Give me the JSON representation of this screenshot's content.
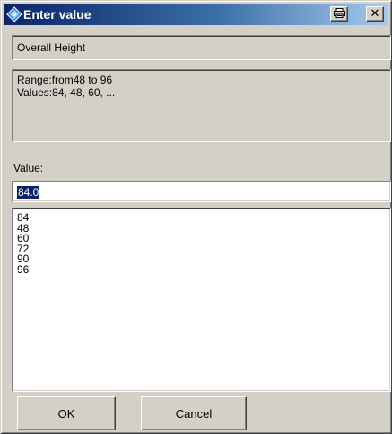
{
  "window": {
    "title": "Enter value",
    "title_icon": "app-diamond-icon",
    "title_buttons": [
      {
        "icon": "print-icon"
      },
      {
        "icon": "close-icon",
        "glyph": "✕"
      }
    ]
  },
  "field": {
    "name": "Overall Height"
  },
  "info": {
    "range_line": "Range:from48 to 96",
    "values_line": "Values:84, 48, 60, ..."
  },
  "value": {
    "label": "Value:",
    "current": "84.0"
  },
  "options": [
    "84",
    "48",
    "60",
    "72",
    "90",
    "96"
  ],
  "buttons": {
    "ok": "OK",
    "cancel": "Cancel"
  },
  "colors": {
    "title_gradient_start": "#0a246a",
    "title_gradient_end": "#a6caf0",
    "face": "#d4d0c8",
    "selection": "#0a246a"
  }
}
